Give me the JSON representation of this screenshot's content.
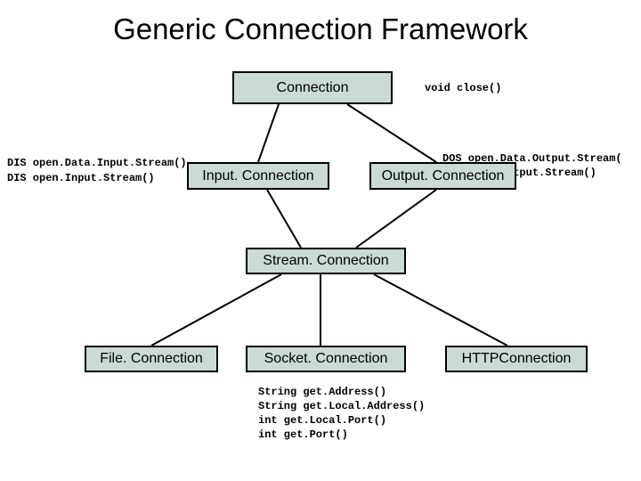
{
  "title": "Generic Connection Framework",
  "boxes": {
    "connection": "Connection",
    "input_connection": "Input. Connection",
    "output_connection": "Output. Connection",
    "stream_connection": "Stream. Connection",
    "file_connection": "File. Connection",
    "socket_connection": "Socket. Connection",
    "http_connection": "HTTPConnection"
  },
  "labels": {
    "close": "void close()",
    "dis1": "DIS open.Data.Input.Stream()",
    "dis2": "DIS open.Input.Stream()",
    "dos1": "DOS open.Data.Output.Stream(",
    "dos2": "DOS open.Output.Stream()",
    "sock1": "String get.Address()",
    "sock2": "String get.Local.Address()",
    "sock3": "int get.Local.Port()",
    "sock4": "int get.Port()"
  }
}
